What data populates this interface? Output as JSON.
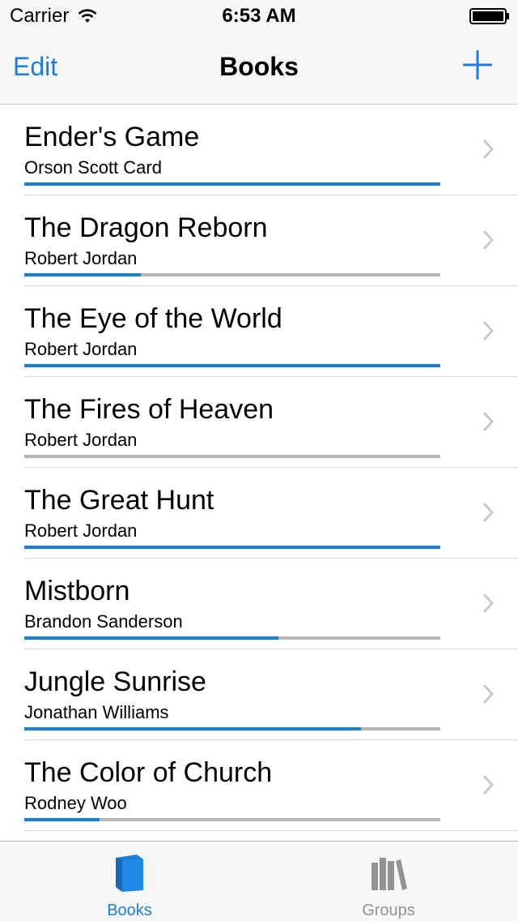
{
  "status_bar": {
    "carrier": "Carrier",
    "time": "6:53 AM"
  },
  "nav": {
    "edit_label": "Edit",
    "title": "Books",
    "add_icon": "plus-icon"
  },
  "colors": {
    "accent": "#1a7fdb",
    "track": "#b7b7b7",
    "inactive": "#929292"
  },
  "books": [
    {
      "title": "Ender's Game",
      "author": "Orson Scott Card",
      "progress": 1.0
    },
    {
      "title": "The Dragon Reborn",
      "author": "Robert Jordan",
      "progress": 0.28
    },
    {
      "title": "The Eye of the World",
      "author": "Robert Jordan",
      "progress": 1.0
    },
    {
      "title": "The Fires of Heaven",
      "author": "Robert Jordan",
      "progress": 0.0
    },
    {
      "title": "The Great Hunt",
      "author": "Robert Jordan",
      "progress": 1.0
    },
    {
      "title": "Mistborn",
      "author": "Brandon Sanderson",
      "progress": 0.61
    },
    {
      "title": "Jungle Sunrise",
      "author": "Jonathan Williams",
      "progress": 0.81
    },
    {
      "title": "The Color of Church",
      "author": "Rodney Woo",
      "progress": 0.18
    }
  ],
  "tabs": [
    {
      "label": "Books",
      "icon": "book-icon",
      "active": true
    },
    {
      "label": "Groups",
      "icon": "shelf-books-icon",
      "active": false
    }
  ]
}
